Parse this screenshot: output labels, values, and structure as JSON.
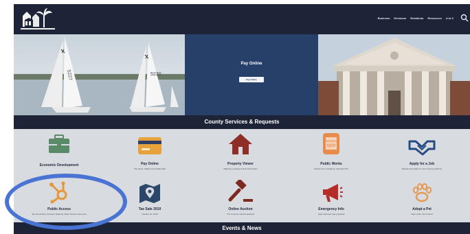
{
  "nav": {
    "items": [
      "Business",
      "Divisions",
      "Residents",
      "Resources",
      "A to Z"
    ]
  },
  "hero": {
    "left_sail_numbers": [
      "5227",
      "5230"
    ],
    "pay_title": "Pay Online",
    "pay_button": "Pay Online"
  },
  "services": {
    "heading": "County Services & Requests",
    "cards": [
      {
        "title": "Economic Development",
        "subtitle": "",
        "icon": "briefcase-icon",
        "color": "#5a8b68"
      },
      {
        "title": "Pay Online",
        "subtitle": "Pay taxes, utilities and related bills",
        "icon": "credit-card-icon",
        "color": "#e7a23c"
      },
      {
        "title": "Property Viewer",
        "subtitle": "Mapping, property & land information",
        "icon": "house-icon",
        "color": "#8f2d27"
      },
      {
        "title": "Public Works",
        "subtitle": "Submit non-emergency requests 24/7",
        "icon": "report-gov-icon",
        "color": "#e88b4d"
      },
      {
        "title": "Apply for a Job",
        "subtitle": "Browse and apply for open county positions",
        "icon": "handshake-icon",
        "color": "#274b83"
      },
      {
        "title": "Public Access",
        "subtitle": "Tax Information, Property Mapping, Deed Indexes and more",
        "icon": "hub-icon",
        "color": "#e7963a"
      },
      {
        "title": "Tax Sale 2019",
        "subtitle": "October 21, 2019",
        "icon": "map-pin-icon",
        "color": "#2d4768"
      },
      {
        "title": "Online Auction",
        "subtitle": "The County's surplus auctions",
        "icon": "gavel-icon",
        "color": "#7c2a22"
      },
      {
        "title": "Emergency Info",
        "subtitle": "Stay informed, stay prepared",
        "icon": "megaphone-icon",
        "color": "#b52c29"
      },
      {
        "title": "Adopt a Pet",
        "subtitle": "Save a life, find a friend",
        "icon": "paw-icon",
        "color": "#e49a55"
      }
    ]
  },
  "events": {
    "heading": "Events & News"
  }
}
